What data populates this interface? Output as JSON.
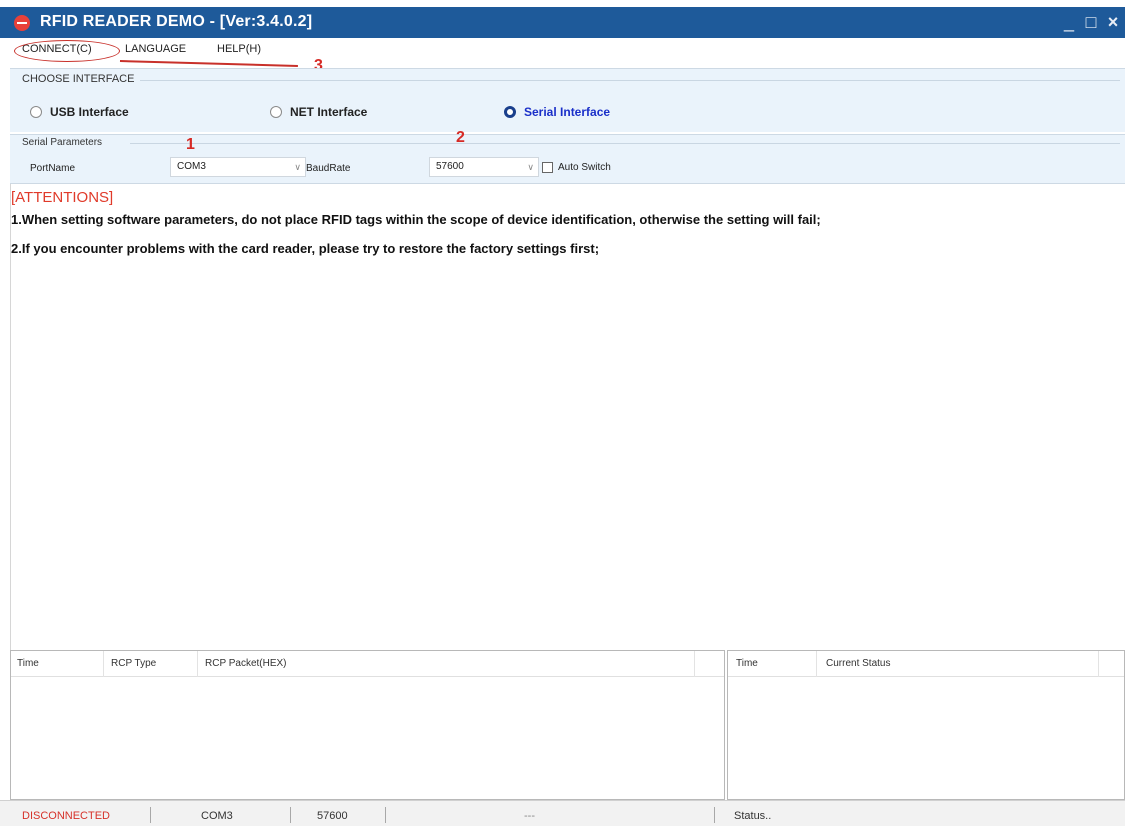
{
  "window": {
    "title": "RFID READER DEMO - [Ver:3.4.0.2]",
    "minimize_glyph": "_",
    "maximize_glyph": "□",
    "close_glyph": "×"
  },
  "menu": {
    "items": [
      {
        "label": "CONNECT(C)"
      },
      {
        "label": "LANGUAGE"
      },
      {
        "label": "HELP(H)"
      }
    ]
  },
  "annotations": {
    "one": "1",
    "two": "2",
    "three": "3"
  },
  "choose_interface": {
    "title": "CHOOSE INTERFACE",
    "options": [
      {
        "label": "USB Interface",
        "selected": false
      },
      {
        "label": "NET Interface",
        "selected": false
      },
      {
        "label": "Serial Interface",
        "selected": true
      }
    ]
  },
  "serial_params": {
    "title": "Serial Parameters",
    "port_label": "PortName",
    "port_value": "COM3",
    "baud_label": "BaudRate",
    "baud_value": "57600",
    "auto_switch_label": "Auto Switch",
    "auto_switch_checked": false
  },
  "attention": {
    "title": "[ATTENTIONS]",
    "lines": [
      "1.When setting software parameters, do not place RFID tags within the scope of device identification, otherwise the setting will fail;",
      "2.If you encounter problems with the card reader, please try to restore the factory settings first;"
    ]
  },
  "log_table": {
    "columns": [
      "Time",
      "RCP Type",
      "RCP Packet(HEX)"
    ]
  },
  "status_table": {
    "columns": [
      "Time",
      "Current Status"
    ]
  },
  "statusbar": {
    "connection": "DISCONNECTED",
    "port": "COM3",
    "baud": "57600",
    "dash": "---",
    "status": "Status.."
  },
  "colors": {
    "title_bar": "#1e5a9a",
    "panel_bg": "#eaf3fb",
    "attention_title": "#e03a2a",
    "selected_radio": "#1a2fc9",
    "annotation": "#d62a25",
    "disconnected": "#d6322a"
  }
}
